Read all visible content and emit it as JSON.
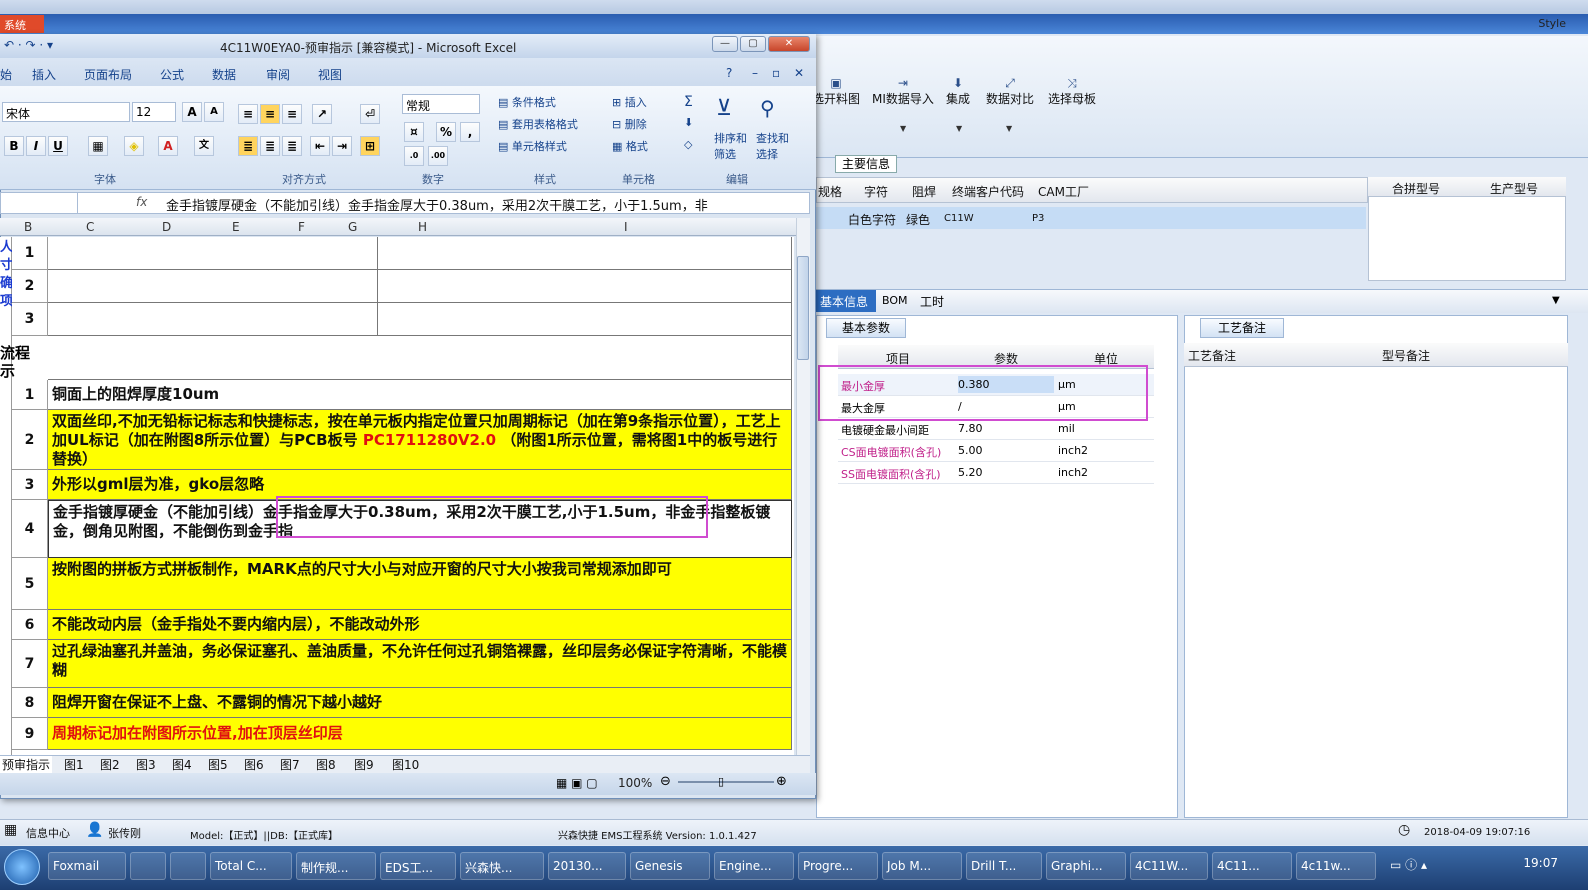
{
  "eds": {
    "system_label": "系统",
    "style_label": "Style",
    "toolbar": [
      {
        "label": "选开料图",
        "icon": "image-icon"
      },
      {
        "label": "MI数据导入",
        "icon": "import-icon"
      },
      {
        "label": "集成",
        "icon": "download-icon"
      },
      {
        "label": "数据对比",
        "icon": "compare-icon"
      },
      {
        "label": "选择母板",
        "icon": "shuffle-icon"
      }
    ],
    "main_info_tab": "主要信息",
    "grid_headers": [
      "规格",
      "字符",
      "阻焊",
      "终端客户代码",
      "CAM工厂"
    ],
    "grid_headers2": [
      "合拼型号",
      "生产型号"
    ],
    "grid_row": [
      "白色字符",
      "绿色",
      "C11W",
      "P3"
    ],
    "tabs": [
      "基本信息",
      "BOM",
      "工时"
    ],
    "basic_params_tab": "基本参数",
    "craft_notes_tab": "工艺备注",
    "param_headers": [
      "项目",
      "参数",
      "单位"
    ],
    "params": [
      {
        "item": "最小金厚",
        "value": "0.380",
        "unit": "μm",
        "red": true
      },
      {
        "item": "最大金厚",
        "value": "/",
        "unit": "μm",
        "red": false
      },
      {
        "item": "电镀硬金最小间距",
        "value": "7.80",
        "unit": "mil",
        "red": false
      },
      {
        "item": "CS面电镀面积(含孔)",
        "value": "5.00",
        "unit": "inch2",
        "red": true
      },
      {
        "item": "SS面电镀面积(含孔)",
        "value": "5.20",
        "unit": "inch2",
        "red": true
      }
    ],
    "notes_headers": [
      "工艺备注",
      "型号备注"
    ],
    "status": {
      "info_center": "信息中心",
      "user": "张传刚",
      "model": "Model:【正式】||DB:【正式库】",
      "app": "兴森快捷 EMS工程系统 Version: 1.0.1.427",
      "datetime": "2018-04-09 19:07:16"
    }
  },
  "excel": {
    "title": "4C11W0EYA0-预审指示 [兼容模式] - Microsoft Excel",
    "tabs": [
      "开始",
      "插入",
      "页面布局",
      "公式",
      "数据",
      "审阅",
      "视图"
    ],
    "font_name": "宋体",
    "font_size": "12",
    "number_format": "常规",
    "ribbon": {
      "conditional": "条件格式",
      "table_format": "套用表格格式",
      "cell_style": "单元格样式",
      "insert": "插入",
      "delete": "删除",
      "format": "格式",
      "sort": "排序和筛选",
      "find": "查找和选择"
    },
    "groups": [
      "字体",
      "对齐方式",
      "数字",
      "样式",
      "单元格",
      "编辑"
    ],
    "formula": "金手指镀厚硬金（不能加引线）金手指金厚大于0.38um，采用2次干膜工艺，小于1.5um，非",
    "columns": [
      "B",
      "C",
      "D",
      "E",
      "F",
      "G",
      "H",
      "I"
    ],
    "left_text": [
      "人",
      "寸",
      "确",
      "项",
      "流程",
      "示"
    ],
    "rows": [
      {
        "n": "1",
        "text": "",
        "yellow": false
      },
      {
        "n": "2",
        "text": "",
        "yellow": false
      },
      {
        "n": "3",
        "text": "",
        "yellow": false
      },
      {
        "n": "1",
        "text": "铜面上的阻焊厚度10um",
        "yellow": false
      },
      {
        "n": "2",
        "text": "双面丝印,不加无铅标记标志和快捷标志，按在单元板内指定位置只加周期标记（加在第9条指示位置），工艺上加UL标记（加在附图8所示位置）与PCB板号 ",
        "red_part": "PC1711280V2.0",
        "tail": " （附图1所示位置，需将图1中的板号进行替换）",
        "yellow": true
      },
      {
        "n": "3",
        "text": "外形以gml层为准，gko层忽略",
        "yellow": true
      },
      {
        "n": "4",
        "text": "金手指镀厚硬金（不能加引线）金手指金厚大于0.38um，采用2次干膜工艺,小于1.5um，非金手指整板镀金，倒角见附图，不能倒伤到金手指",
        "yellow": false
      },
      {
        "n": "5",
        "text": "按附图的拼板方式拼板制作，MARK点的尺寸大小与对应开窗的尺寸大小按我司常规添加即可",
        "yellow": true
      },
      {
        "n": "6",
        "text": "不能改动内层（金手指处不要内缩内层），不能改动外形",
        "yellow": true
      },
      {
        "n": "7",
        "text": "过孔绿油塞孔并盖油，务必保证塞孔、盖油质量，不允许任何过孔铜箔裸露，丝印层务必保证字符清晰，不能模糊",
        "yellow": true
      },
      {
        "n": "8",
        "text": "阻焊开窗在保证不上盘、不露铜的情况下越小越好",
        "yellow": true
      },
      {
        "n": "9",
        "text": "周期标记加在附图所示位置,加在顶层丝印层",
        "yellow": true,
        "red": true
      }
    ],
    "sheet_tabs": [
      "预审指示",
      "图1",
      "图2",
      "图3",
      "图4",
      "图5",
      "图6",
      "图7",
      "图8",
      "图9",
      "图10"
    ],
    "zoom": "100%"
  },
  "taskbar": {
    "items": [
      "Foxmail",
      "",
      "",
      "Total C...",
      "制作规...",
      "EDS工...",
      "兴森快...",
      "20130...",
      "Genesis",
      "Engine...",
      "Progre...",
      "Job M...",
      "Drill T...",
      "Graphi...",
      "4C11W...",
      "4C11...",
      "4c11w..."
    ],
    "clock": "19:07"
  }
}
